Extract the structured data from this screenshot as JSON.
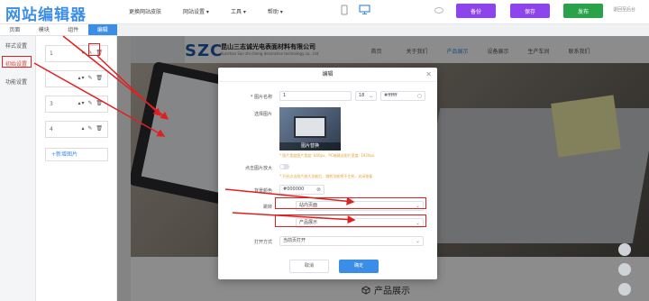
{
  "app": {
    "logo": "网站编辑器"
  },
  "topnav": [
    "更换网站皮肤",
    "网站设置 ▾",
    "工具 ▾",
    "帮助 ▾"
  ],
  "topbuttons": {
    "backup": "备份",
    "save": "保存",
    "publish": "发布",
    "exit": "退回至后台"
  },
  "colors": {
    "purple": "#8e44ec",
    "green": "#2aa24a",
    "accent": "#3b8ee8",
    "annotation": "#e02020"
  },
  "tabs": [
    "页面",
    "模块",
    "组件",
    "编辑"
  ],
  "sidebar": {
    "items": [
      "样式设置",
      "初始设置",
      "功能设置"
    ]
  },
  "slides": {
    "items": [
      "1",
      "2",
      "3",
      "4"
    ],
    "add_label": "+新增图片"
  },
  "site": {
    "logo": "SZC",
    "company": "昆山三志诚光电表面材料有限公司",
    "company_en": "Kunshan San zhi cheng decorative technology co., Ltd",
    "nav": [
      "首页",
      "关于我们",
      "产品展示",
      "设备展示",
      "生产车间",
      "联系我们"
    ],
    "products_heading": "产品展示"
  },
  "modal": {
    "title": "编辑",
    "fields": {
      "name_label": "* 图片名称",
      "name_value": "1",
      "font_size": "18",
      "color_value": "#ffffff",
      "select_image_label": "选择图片",
      "replace_label": "图片替换",
      "size_note": "* 图片宽度图片宽度: 640px，PC端建议图片宽度: 1920px",
      "enlarge_label": "点击图片放大",
      "enlarge_note": "* 开启点击图片放大功能后，跳转功能将不生效，关闭恢复",
      "bg_label": "背景颜色",
      "bg_value": "#000000",
      "jump_label": "跳转",
      "jump_value": "站内页面",
      "page_value": "产品展示",
      "open_label": "打开方式",
      "open_value": "当前页打开"
    },
    "cancel": "取消",
    "confirm": "确定"
  }
}
